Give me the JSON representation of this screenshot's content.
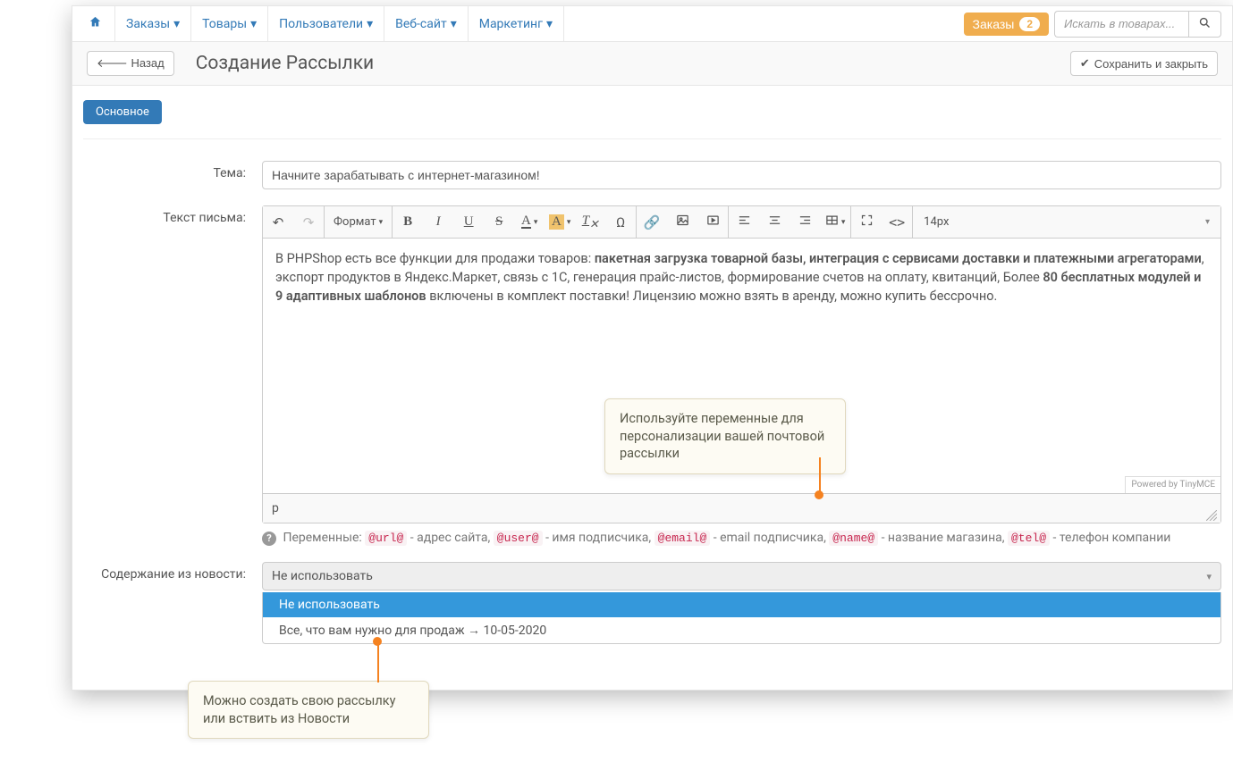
{
  "nav": {
    "orders": "Заказы",
    "products": "Товары",
    "users": "Пользователи",
    "website": "Веб-сайт",
    "marketing": "Маркетинг"
  },
  "header": {
    "orders_btn": "Заказы",
    "orders_count": "2",
    "search_placeholder": "Искать в товарах..."
  },
  "page": {
    "back": "Назад",
    "title": "Создание Рассылки",
    "save": "Сохранить и закрыть",
    "tab_main": "Основное"
  },
  "form": {
    "subject_label": "Тема:",
    "subject_value": "Начните зарабатывать с интернет-магазином!",
    "body_label": "Текст письма:",
    "news_label": "Содержание из новости:"
  },
  "editor": {
    "format": "Формат",
    "fontsize": "14px",
    "text_pre": "В PHPShop есть все функции для продажи товаров: ",
    "text_bold1": "пакетная загрузка товарной базы, интеграция с сервисами доставки и платежными агрегаторами",
    "text_mid": ", экспорт продуктов в Яндекс.Маркет, связь с 1С, генерация прайс-листов, формирование счетов на оплату, квитанций, Более ",
    "text_bold2": "80 бесплатных модулей и 9 адаптивных шаблонов",
    "text_post": " включены в комплект поставки! Лицензию можно взять в аренду, можно купить бессрочно.",
    "path": "p",
    "powered": "Powered by TinyMCE"
  },
  "vars": {
    "label": "Переменные: ",
    "url": "@url@",
    "url_desc": " - адрес сайта, ",
    "user": "@user@",
    "user_desc": " - имя подписчика, ",
    "email": "@email@",
    "email_desc": " - email подписчика, ",
    "name": "@name@",
    "name_desc": " - название магазина, ",
    "tel": "@tel@",
    "tel_desc": " - телефон компании"
  },
  "news_select": {
    "current": "Не использовать",
    "options": [
      "Не использовать",
      "Все, что вам нужно для продаж → 10-05-2020"
    ]
  },
  "callouts": {
    "vars_tip": "Используйте переменные для персонализации вашей почтовой рассылки",
    "news_tip": "Можно создать свою рассылку или вствить из Новости"
  }
}
